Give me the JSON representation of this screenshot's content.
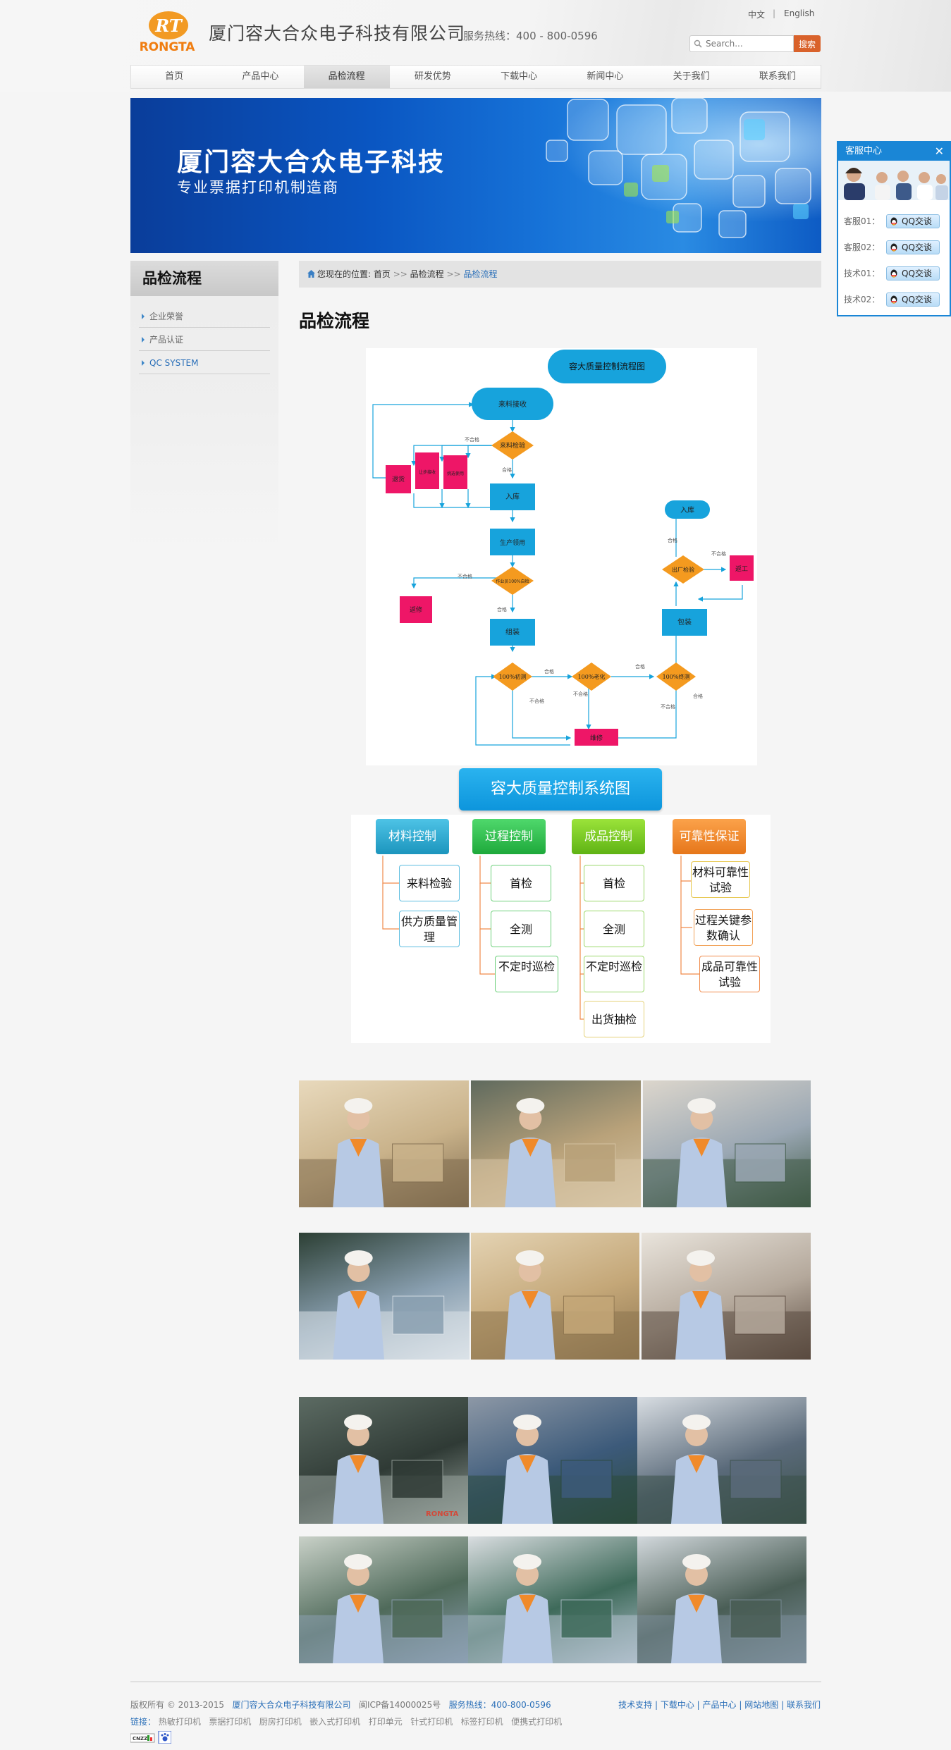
{
  "header": {
    "logo_text": "RONGTA",
    "logo_mark": "RT",
    "company_name": "厦门容大合众电子科技有限公司",
    "hotline": "服务热线：400 - 800-0596",
    "lang_zh": "中文",
    "lang_sep": "|",
    "lang_en": "English",
    "search_placeholder": "Search...",
    "search_button": "搜索"
  },
  "nav": {
    "items": [
      "首页",
      "产品中心",
      "品检流程",
      "研发优势",
      "下载中心",
      "新闻中心",
      "关于我们",
      "联系我们"
    ],
    "active_index": 2
  },
  "banner": {
    "title": "厦门容大合众电子科技",
    "subtitle": "专业票据打印机制造商"
  },
  "sidebar": {
    "title": "品检流程",
    "items": [
      "企业荣誉",
      "产品认证",
      "QC SYSTEM"
    ],
    "active_index": 2
  },
  "breadcrumb": {
    "prefix": "您现在的位置:",
    "home": "首页",
    "sep": ">>",
    "parent": "品检流程",
    "current": "品检流程"
  },
  "page_title": "品检流程",
  "flowchart": {
    "title": "容大质量控制流程图",
    "nodes": {
      "incoming": "来料接收",
      "incoming_check": "来料检验",
      "return": "退货",
      "concession": "让步接收",
      "select": "挑选使用",
      "storage": "入库",
      "production": "生产领用",
      "self_check": "作业员100%自检",
      "repair": "返修",
      "assembly": "组装",
      "initial_test": "100%初测",
      "aging": "100%老化",
      "final_test": "100%终测",
      "maintenance": "维修",
      "packing": "包装",
      "factory_check": "出厂检验",
      "warehouse": "入库",
      "rework": "返工"
    },
    "labels": {
      "pass": "合格",
      "fail": "不合格"
    }
  },
  "qc_system": {
    "title": "容大质量控制系统图",
    "columns": [
      {
        "header": "材料控制",
        "items": [
          "来料检验",
          "供方质量管理"
        ],
        "color": "#2aa6c9"
      },
      {
        "header": "过程控制",
        "items": [
          "首检",
          "全测",
          "不定时巡检"
        ],
        "color": "#2cc04a"
      },
      {
        "header": "成品控制",
        "items": [
          "首检",
          "全测",
          "不定时巡检",
          "出货抽检"
        ],
        "color": "#7ac919"
      },
      {
        "header": "可靠性保证",
        "items": [
          "材料可靠性试验",
          "过程关键参数确认",
          "成品可靠性试验"
        ],
        "color": "#f08522"
      }
    ]
  },
  "photos": {
    "rows": 4,
    "per_row": 3,
    "watermark": "RONGTA"
  },
  "service": {
    "title": "客服中心",
    "close": "✕",
    "rows": [
      {
        "label": "客服01：",
        "btn": "QQ交谈"
      },
      {
        "label": "客服02：",
        "btn": "QQ交谈"
      },
      {
        "label": "技术01：",
        "btn": "QQ交谈"
      },
      {
        "label": "技术02：",
        "btn": "QQ交谈"
      }
    ]
  },
  "footer": {
    "copyright": "版权所有 © 2013-2015",
    "company": "厦门容大合众电子科技有限公司",
    "icp": "闽ICP备14000025号",
    "hotline": "服务热线：400-800-0596",
    "links": [
      "技术支持",
      "下载中心",
      "产品中心",
      "网站地图",
      "联系我们"
    ],
    "links_sep": "|",
    "tags_label": "链接：",
    "tags": [
      "热敏打印机",
      "票据打印机",
      "厨房打印机",
      "嵌入式打印机",
      "打印单元",
      "针式打印机",
      "标签打印机",
      "便携式打印机"
    ],
    "badge1": "CNZZ"
  },
  "colors": {
    "accent": "#d9622b",
    "link": "#2a6fb8",
    "flow_blue": "#17a3dc",
    "flow_pink": "#ee1667",
    "flow_orange": "#f49a1f"
  }
}
